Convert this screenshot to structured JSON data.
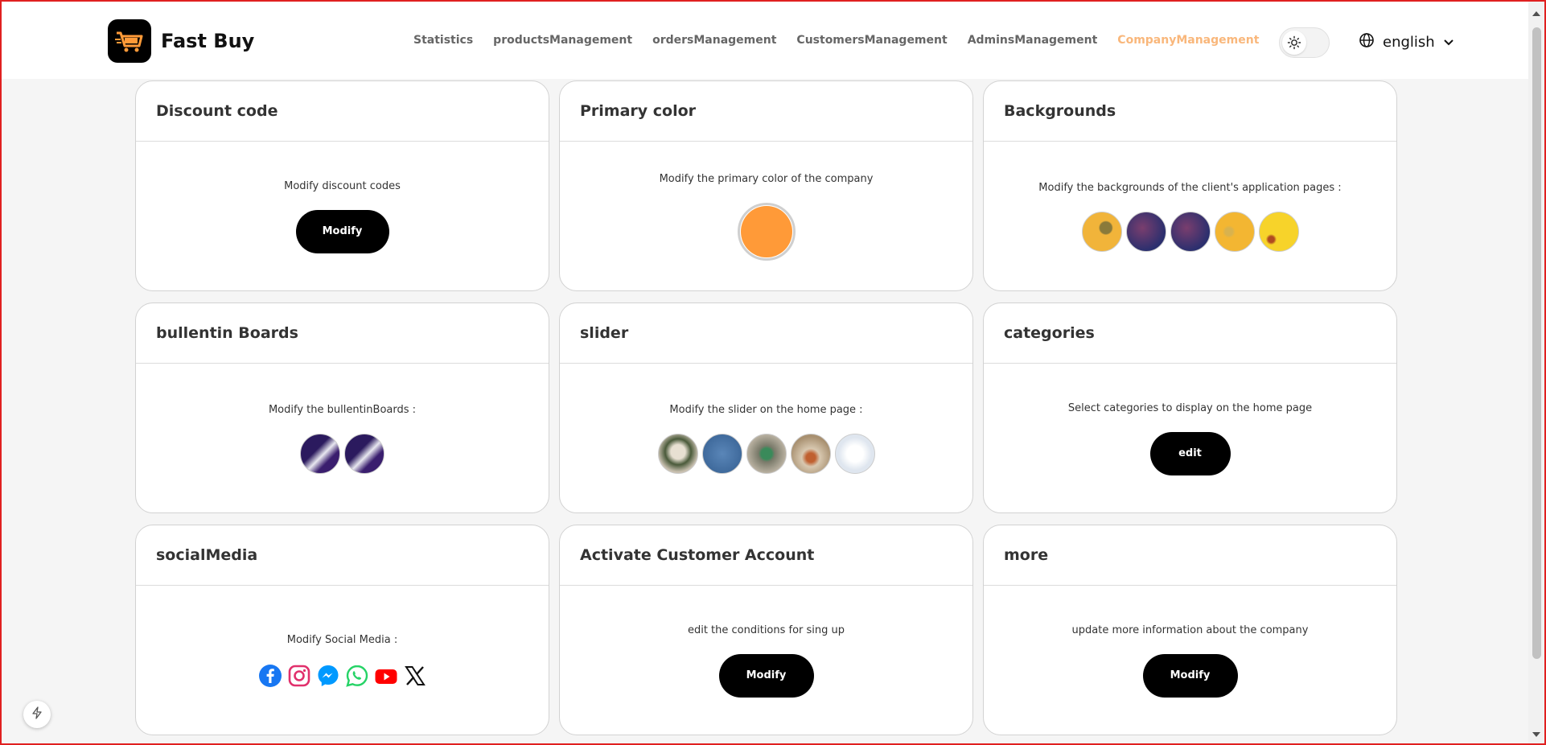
{
  "brand": {
    "name": "Fast Buy"
  },
  "nav": {
    "items": [
      "Statistics",
      "productsManagement",
      "ordersManagement",
      "CustomersManagement",
      "AdminsManagement",
      "CompanyManagement"
    ],
    "active": "CompanyManagement"
  },
  "language": {
    "selected": "english"
  },
  "cards": {
    "discount": {
      "title": "Discount code",
      "desc": "Modify discount codes",
      "button": "Modify"
    },
    "primary": {
      "title": "Primary color",
      "desc": "Modify the primary color of the company",
      "color": "#ff9a38"
    },
    "backgrounds": {
      "title": "Backgrounds",
      "desc": "Modify the backgrounds of the client's application pages :"
    },
    "bulletin": {
      "title": "bullentin Boards",
      "desc": "Modify the bullentinBoards :"
    },
    "slider": {
      "title": "slider",
      "desc": "Modify the slider on the home page :"
    },
    "categories": {
      "title": "categories",
      "desc": "Select categories to display on the home page",
      "button": "edit"
    },
    "social": {
      "title": "socialMedia",
      "desc": "Modify Social Media :",
      "icons": [
        "facebook-icon",
        "instagram-icon",
        "messenger-icon",
        "whatsapp-icon",
        "youtube-icon",
        "x-icon"
      ]
    },
    "activate": {
      "title": "Activate Customer Account",
      "desc": "edit the conditions for sing up",
      "button": "Modify"
    },
    "more": {
      "title": "more",
      "desc": "update more information about the company",
      "button": "Modify"
    }
  },
  "colors": {
    "accent": "#f9b77b",
    "primary": "#ff9a38",
    "button": "#000000"
  }
}
